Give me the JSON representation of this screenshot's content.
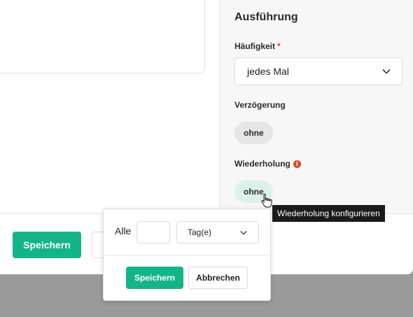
{
  "panel": {
    "title": "Ausführung",
    "frequency": {
      "label": "Häufigkeit",
      "required_mark": "*",
      "selected": "jedes Mal"
    },
    "delay": {
      "label": "Verzögerung",
      "value": "ohne"
    },
    "repetition": {
      "label": "Wiederholung",
      "value": "ohne"
    }
  },
  "tooltip": {
    "text": "Wiederholung konfigurieren"
  },
  "footer": {
    "save_label": "Speichern"
  },
  "popover": {
    "every_label": "Alle",
    "count_value": "",
    "unit_selected": "Tag(e)",
    "save_label": "Speichern",
    "cancel_label": "Abbrechen"
  },
  "colors": {
    "accent": "#14b48a",
    "required": "#e0452b",
    "tooltip_bg": "#1a1a1a",
    "backdrop": "#9a9a9a"
  },
  "icons": [
    "info-icon",
    "chevron-down-icon",
    "hand-cursor-icon"
  ]
}
